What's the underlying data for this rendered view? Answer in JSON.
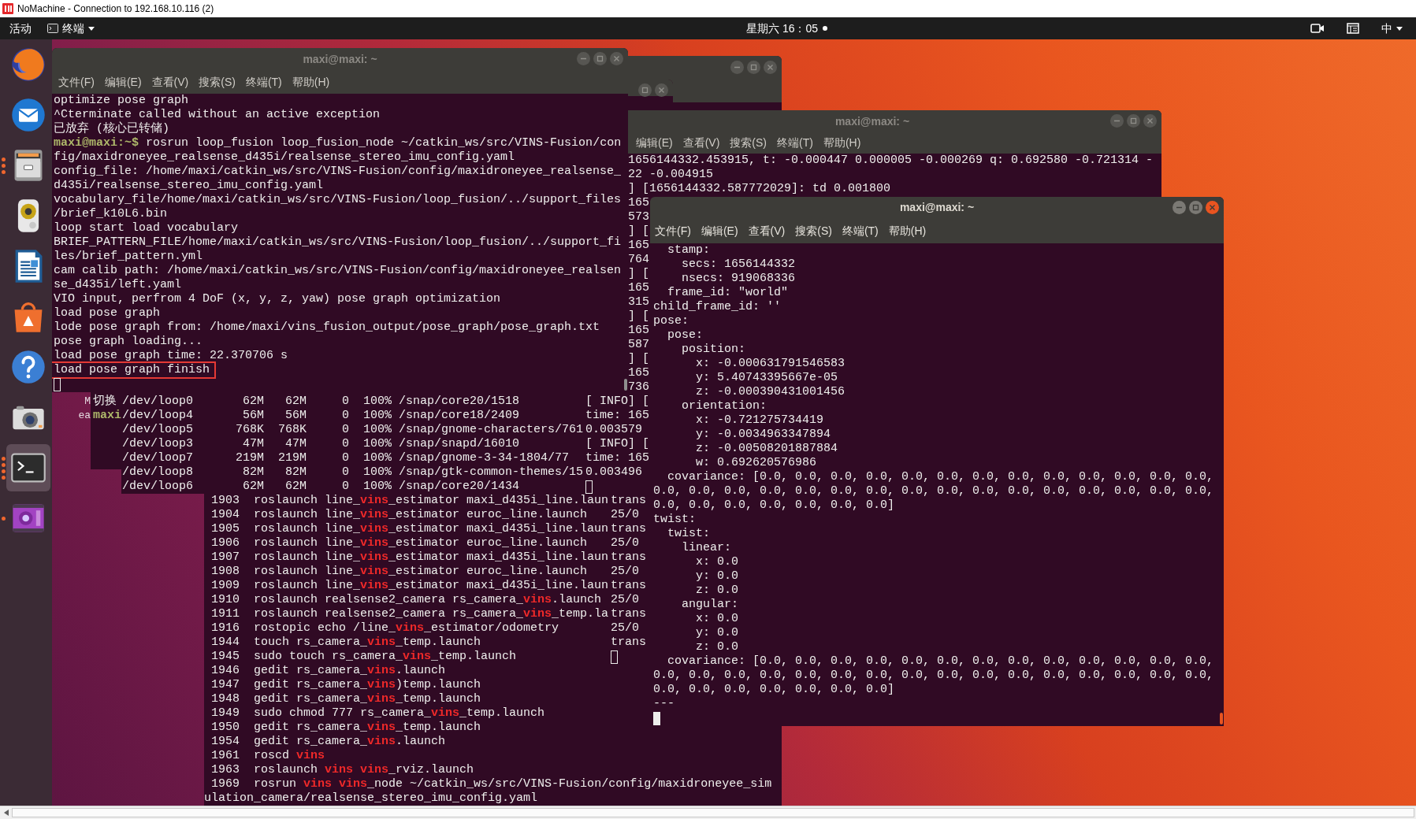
{
  "nomachine_window": {
    "title": "NoMachine - Connection to 192.168.10.116 (2)"
  },
  "top_bar": {
    "activities": "活动",
    "app_menu": "终端",
    "clock": "星期六 16：05",
    "input_method": "中"
  },
  "dock": [
    {
      "kind": "browser",
      "running": false,
      "selected": false
    },
    {
      "kind": "mail",
      "running": false,
      "selected": false
    },
    {
      "kind": "files",
      "running": true,
      "open_windows": [
        {
          "kind": "dot"
        },
        {
          "kind": "dot"
        },
        {
          "kind": "dot"
        }
      ],
      "selected": false
    },
    {
      "kind": "music",
      "running": false,
      "selected": false
    },
    {
      "kind": "writer",
      "running": false,
      "selected": false
    },
    {
      "kind": "software",
      "running": false,
      "selected": false
    },
    {
      "kind": "help",
      "running": false,
      "selected": false
    },
    {
      "kind": "camera",
      "running": false,
      "selected": false
    },
    {
      "kind": "terminal",
      "running": true,
      "open_windows": [
        {
          "kind": "dot"
        },
        {
          "kind": "dot"
        },
        {
          "kind": "dot"
        },
        {
          "kind": "dot"
        }
      ],
      "selected": true
    },
    {
      "kind": "video",
      "running": true,
      "open_windows": [
        {
          "kind": "dot"
        }
      ],
      "selected": false
    }
  ],
  "windows": [
    {
      "kind": "terminal",
      "title": "maxi@maxi: ~",
      "focused": false,
      "buttons": [
        {
          "kind": "minimize"
        },
        {
          "kind": "maximize"
        },
        {
          "kind": "close"
        }
      ],
      "menu": [
        "文件(F)",
        "编辑(E)",
        "查看(V)",
        "搜索(S)",
        "终端(T)",
        "帮助(H)"
      ],
      "lines": [
        "optimize pose graph",
        "^Cterminate called without an active exception",
        "已放弃 (核心已转储)",
        "**maxi@maxi:~$** rosrun loop_fusion loop_fusion_node ~/catkin_ws/src/VINS-Fusion/con",
        "fig/maxidroneyee_realsense_d435i/realsense_stereo_imu_config.yaml",
        "config_file: /home/maxi/catkin_ws/src/VINS-Fusion/config/maxidroneyee_realsense_",
        "d435i/realsense_stereo_imu_config.yaml",
        "vocabulary_file/home/maxi/catkin_ws/src/VINS-Fusion/loop_fusion/../support_files",
        "/brief_k10L6.bin",
        "loop start load vocabulary",
        "BRIEF_PATTERN_FILE/home/maxi/catkin_ws/src/VINS-Fusion/loop_fusion/../support_fi",
        "les/brief_pattern.yml",
        "cam calib path: /home/maxi/catkin_ws/src/VINS-Fusion/config/maxidroneyee_realsen",
        "se_d435i/left.yaml",
        "VIO input, perfrom 4 DoF (x, y, z, yaw) pose graph optimization",
        "load pose graph",
        "lode pose graph from: /home/maxi/vins_fusion_output/pose_graph/pose_graph.txt",
        "pose graph loading...",
        "load pose graph time: 22.370706 s"
      ],
      "marked_line": "load pose graph finish",
      "cursor": true
    },
    {
      "kind": "terminal",
      "focused": false,
      "buttons": [
        {
          "kind": "minimize"
        },
        {
          "kind": "maximize"
        },
        {
          "kind": "close"
        }
      ],
      "lines": [
        " 1903  roslaunch line_**vins**_estimator maxi_d435i_line.laun",
        " 1904  roslaunch line_**vins**_estimator euroc_line.launch",
        " 1905  roslaunch line_**vins**_estimator maxi_d435i_line.laun",
        " 1906  roslaunch line_**vins**_estimator euroc_line.launch",
        " 1907  roslaunch line_**vins**_estimator maxi_d435i_line.laun",
        " 1908  roslaunch line_**vins**_estimator euroc_line.launch",
        " 1909  roslaunch line_**vins**_estimator maxi_d435i_line.laun",
        " 1910  roslaunch realsense2_camera rs_camera_**vins**.launch",
        " 1911  roslaunch realsense2_camera rs_camera_**vins**_temp.la",
        " 1916  rostopic echo /line_**vins**_estimator/odometry",
        " 1944  touch rs_camera_**vins**_temp.launch",
        " 1945  sudo touch rs_camera_**vins**_temp.launch",
        " 1946  gedit rs_camera_**vins**.launch",
        " 1947  gedit rs_camera_**vins**)temp.launch",
        " 1948  gedit rs_camera_**vins**_temp.launch",
        " 1949  sudo chmod 777 rs_camera_**vins**_temp.launch",
        " 1950  gedit rs_camera_**vins**_temp.launch",
        " 1954  gedit rs_camera_**vins**.launch",
        " 1961  roscd **vins**",
        " 1963  roslaunch **vins** **vins**_rviz.launch",
        " 1969  rosrun **vins** **vins**_node ~/catkin_ws/src/VINS-Fusion/config/maxidroneyee_sim",
        "ulation_camera/realsense_stereo_imu_config.yaml"
      ]
    },
    {
      "kind": "terminal",
      "focused": false,
      "buttons": [
        {
          "kind": "maximize"
        },
        {
          "kind": "close"
        }
      ]
    },
    {
      "kind": "terminal",
      "title": "maxi@maxi: ~",
      "focused": false,
      "buttons": [
        {
          "kind": "minimize"
        },
        {
          "kind": "maximize"
        },
        {
          "kind": "close"
        }
      ],
      "menu": [
        "编辑(E)",
        "查看(V)",
        "搜索(S)",
        "终端(T)",
        "帮助(H)"
      ],
      "upper_lines": [
        "1656144332.453915, t: -0.000447 0.000005 -0.000269 q: 0.692580 -0.721314 -",
        "22 -0.004915",
        "] [1656144332.587772029]: td 0.001800",
        "165",
        "573",
        "] [",
        "165",
        "764",
        "] [",
        "165",
        "315",
        "] [",
        "165",
        "587",
        "] [",
        "165",
        "736"
      ],
      "lower_lines": [
        "[ INFO] [",
        "time: 165",
        "0.003579",
        "[ INFO] [",
        "time: 165",
        "0.003496"
      ],
      "cursor": true
    },
    {
      "kind": "terminal",
      "title": "maxi@maxi: ~",
      "focused": true,
      "buttons": [
        {
          "kind": "minimize"
        },
        {
          "kind": "maximize"
        },
        {
          "kind": "close"
        }
      ],
      "menu": [
        "文件(F)",
        "编辑(E)",
        "查看(V)",
        "搜索(S)",
        "终端(T)",
        "帮助(H)"
      ],
      "lines": [
        "  stamp:",
        "    secs: 1656144332",
        "    nsecs: 919068336",
        "  frame_id: \"world\"",
        "child_frame_id: ''",
        "pose:",
        "  pose:",
        "    position:",
        "      x: -0.000631791546583",
        "      y: 5.40743395667e-05",
        "      z: -0.000390431001456",
        "    orientation:",
        "      x: -0.721275734419",
        "      y: -0.0034963347894",
        "      z: -0.00508201887884",
        "      w: 0.692620576986",
        "  covariance: [0.0, 0.0, 0.0, 0.0, 0.0, 0.0, 0.0, 0.0, 0.0, 0.0, 0.0, 0.0, 0.0,",
        "0.0, 0.0, 0.0, 0.0, 0.0, 0.0, 0.0, 0.0, 0.0, 0.0, 0.0, 0.0, 0.0, 0.0, 0.0, 0.0,",
        "0.0, 0.0, 0.0, 0.0, 0.0, 0.0, 0.0]",
        "twist:",
        "  twist:",
        "    linear:",
        "      x: 0.0",
        "      y: 0.0",
        "      z: 0.0",
        "    angular:",
        "      x: 0.0",
        "      y: 0.0",
        "      z: 0.0",
        "  covariance: [0.0, 0.0, 0.0, 0.0, 0.0, 0.0, 0.0, 0.0, 0.0, 0.0, 0.0, 0.0, 0.0,",
        "0.0, 0.0, 0.0, 0.0, 0.0, 0.0, 0.0, 0.0, 0.0, 0.0, 0.0, 0.0, 0.0, 0.0, 0.0, 0.0,",
        "0.0, 0.0, 0.0, 0.0, 0.0, 0.0, 0.0]",
        "---"
      ],
      "cursor": true
    },
    {
      "kind": "fragment",
      "lines": [
        "M",
        "ea"
      ]
    },
    {
      "kind": "terminal",
      "lines": [
        {
          "kind": "output",
          "text": "切换"
        },
        {
          "kind": "prompt",
          "text": "maxi"
        }
      ]
    },
    {
      "kind": "terminal",
      "lines": [
        "/dev/loop0       62M   62M     0  100% /snap/core20/1518",
        "/dev/loop4       56M   56M     0  100% /snap/core18/2409",
        "/dev/loop5      768K  768K     0  100% /snap/gnome-characters/761",
        "/dev/loop3       47M   47M     0  100% /snap/snapd/16010",
        "/dev/loop7      219M  219M     0  100% /snap/gnome-3-34-1804/77",
        "/dev/loop8       82M   82M     0  100% /snap/gtk-common-themes/15",
        "/dev/loop6       62M   62M     0  100% /snap/core20/1434"
      ]
    },
    {
      "kind": "terminal",
      "focused": false,
      "lines": [
        "trans",
        "25/0",
        "trans",
        "25/0",
        "trans",
        "25/0",
        "trans",
        "25/0",
        "trans",
        "25/0",
        "trans"
      ],
      "cursor": true
    }
  ]
}
